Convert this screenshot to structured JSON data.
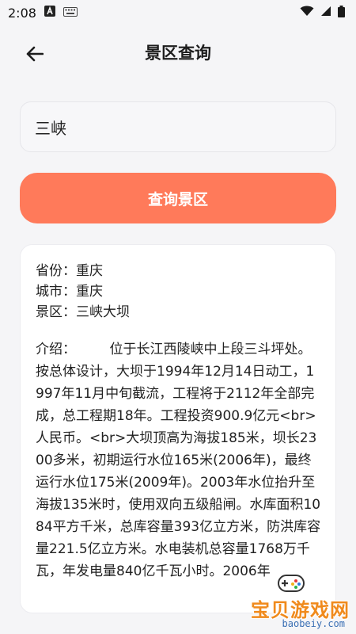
{
  "status_bar": {
    "time": "2:08",
    "icons": [
      "a-notification-icon",
      "keyboard-icon",
      "wifi-icon",
      "signal-icon",
      "battery-icon"
    ]
  },
  "header": {
    "title": "景区查询",
    "back_icon": "arrow-left-icon"
  },
  "search": {
    "value": "三峡",
    "placeholder": ""
  },
  "query_button": {
    "label": "查询景区"
  },
  "result": {
    "province": "省份：重庆",
    "city": "城市：重庆",
    "scenic": "景区：三峡大坝",
    "intro": "介绍：　　　位于长江西陵峡中上段三斗坪处。按总体设计，大坝于1994年12月14日动工，1997年11月中旬截流，工程将于2112年全部完成，总工程期18年。工程投资900.9亿元<br>人民币。<br>大坝顶高为海拔185米，坝长2300多米，初期运行水位165米(2006年)，最终运行水位175米(2009年)。2003年水位抬升至海拔135米时，使用双向五级船闸。水库面积1084平方千米，总库容量393亿立方米，防洪库容量221.5亿立方米。水电装机总容量1768万千瓦，年发电量840亿千瓦小时。2006年"
  },
  "watermark": {
    "text": "宝贝游戏网",
    "url": "baobeiy.com"
  },
  "colors": {
    "accent": "#ff7a5a",
    "background": "#f5f5f7",
    "card": "#ffffff"
  }
}
